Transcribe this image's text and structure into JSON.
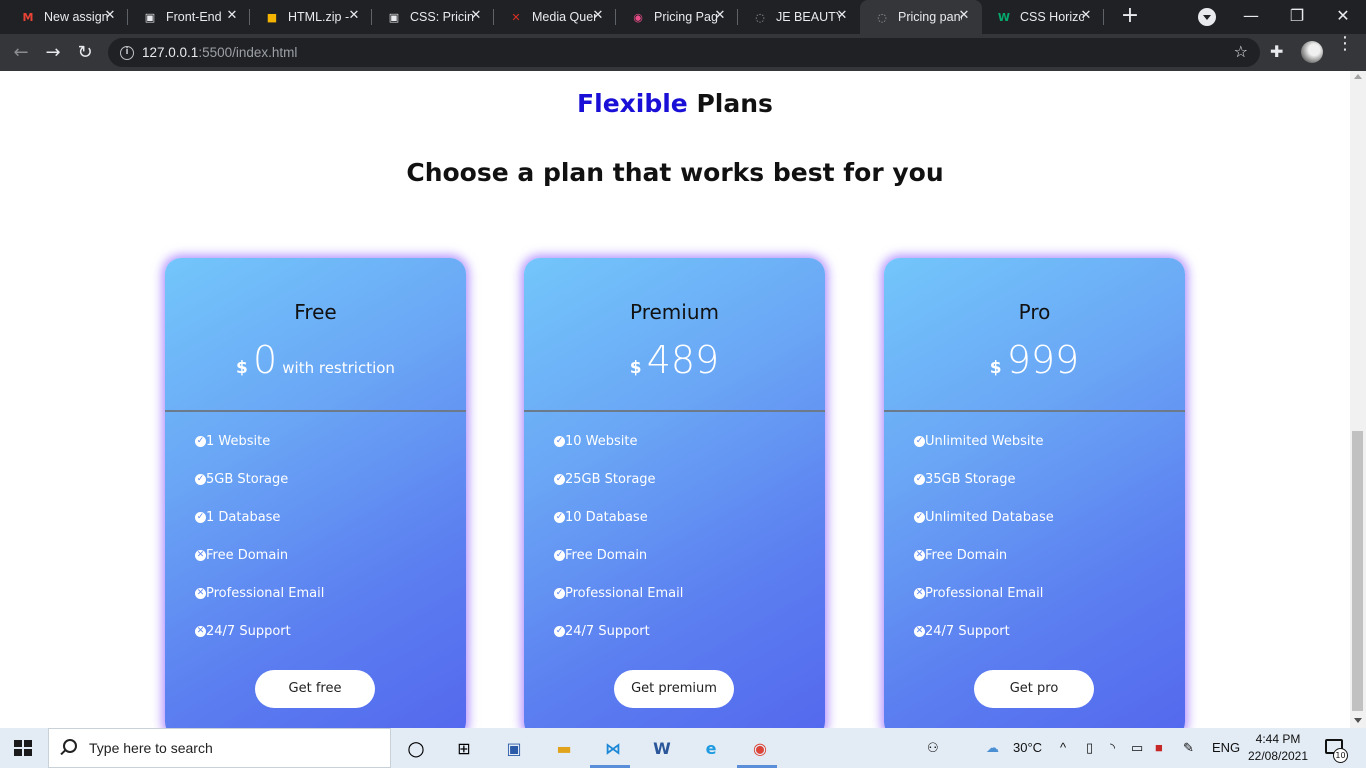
{
  "browser": {
    "tabs": [
      {
        "title": "New assignment",
        "icon": "gmail-icon",
        "icon_glyph": "M",
        "icon_color": "#ea4335"
      },
      {
        "title": "Front-End",
        "icon": "classroom-icon",
        "icon_glyph": "▣",
        "icon_color": "#e8eaed"
      },
      {
        "title": "HTML.zip - ",
        "icon": "drive-file-icon",
        "icon_glyph": "■",
        "icon_color": "#f4b400"
      },
      {
        "title": "CSS: Pricing",
        "icon": "classroom-icon",
        "icon_glyph": "▣",
        "icon_color": "#e8eaed"
      },
      {
        "title": "Media Queries",
        "icon": "media-icon",
        "icon_glyph": "✕",
        "icon_color": "#d93025"
      },
      {
        "title": "Pricing Page",
        "icon": "dribbble-icon",
        "icon_glyph": "◉",
        "icon_color": "#ea4c89"
      },
      {
        "title": "JE BEAUTY",
        "icon": "globe-icon",
        "icon_glyph": "◌",
        "icon_color": "#9aa0a6"
      },
      {
        "title": "Pricing panel",
        "icon": "globe-icon",
        "icon_glyph": "◌",
        "icon_color": "#9aa0a6"
      },
      {
        "title": "CSS Horizontal",
        "icon": "w3schools-icon",
        "icon_glyph": "W",
        "icon_color": "#04aa6d"
      }
    ],
    "active_tab_index": 7,
    "url_host": "127.0.0.1",
    "url_rest": ":5500/index.html"
  },
  "page": {
    "heading_accent": "Flexible",
    "heading_rest": "Plans",
    "subheading": "Choose a plan that works best for you",
    "plans": [
      {
        "name": "Free",
        "currency": "$",
        "amount": "0",
        "note": "with restriction",
        "features": [
          {
            "text": "1 Website",
            "included": true
          },
          {
            "text": "5GB Storage",
            "included": true
          },
          {
            "text": "1 Database",
            "included": true
          },
          {
            "text": "Free Domain",
            "included": false
          },
          {
            "text": "Professional Email",
            "included": false
          },
          {
            "text": "24/7 Support",
            "included": false
          }
        ],
        "button": "Get free"
      },
      {
        "name": "Premium",
        "currency": "$",
        "amount": "489",
        "note": "",
        "features": [
          {
            "text": "10 Website",
            "included": true
          },
          {
            "text": "25GB Storage",
            "included": true
          },
          {
            "text": "10 Database",
            "included": true
          },
          {
            "text": "Free Domain",
            "included": true
          },
          {
            "text": "Professional Email",
            "included": true
          },
          {
            "text": "24/7 Support",
            "included": true
          }
        ],
        "button": "Get premium"
      },
      {
        "name": "Pro",
        "currency": "$",
        "amount": "999",
        "note": "",
        "features": [
          {
            "text": "Unlimited Website",
            "included": true
          },
          {
            "text": "35GB Storage",
            "included": true
          },
          {
            "text": "Unlimited Database",
            "included": true
          },
          {
            "text": "Free Domain",
            "included": false
          },
          {
            "text": "Professional Email",
            "included": false
          },
          {
            "text": "24/7 Support",
            "included": false
          }
        ],
        "button": "Get pro"
      }
    ]
  },
  "taskbar": {
    "search_placeholder": "Type here to search",
    "temperature": "30°C",
    "language": "ENG",
    "time": "4:44 PM",
    "date": "22/08/2021",
    "notification_count": "10"
  },
  "colors": {
    "heading_accent": "#1a0fd6",
    "card_gradient_start": "#73c6fb",
    "card_gradient_end": "#5468ee",
    "card_glow": "#8c5aff"
  }
}
